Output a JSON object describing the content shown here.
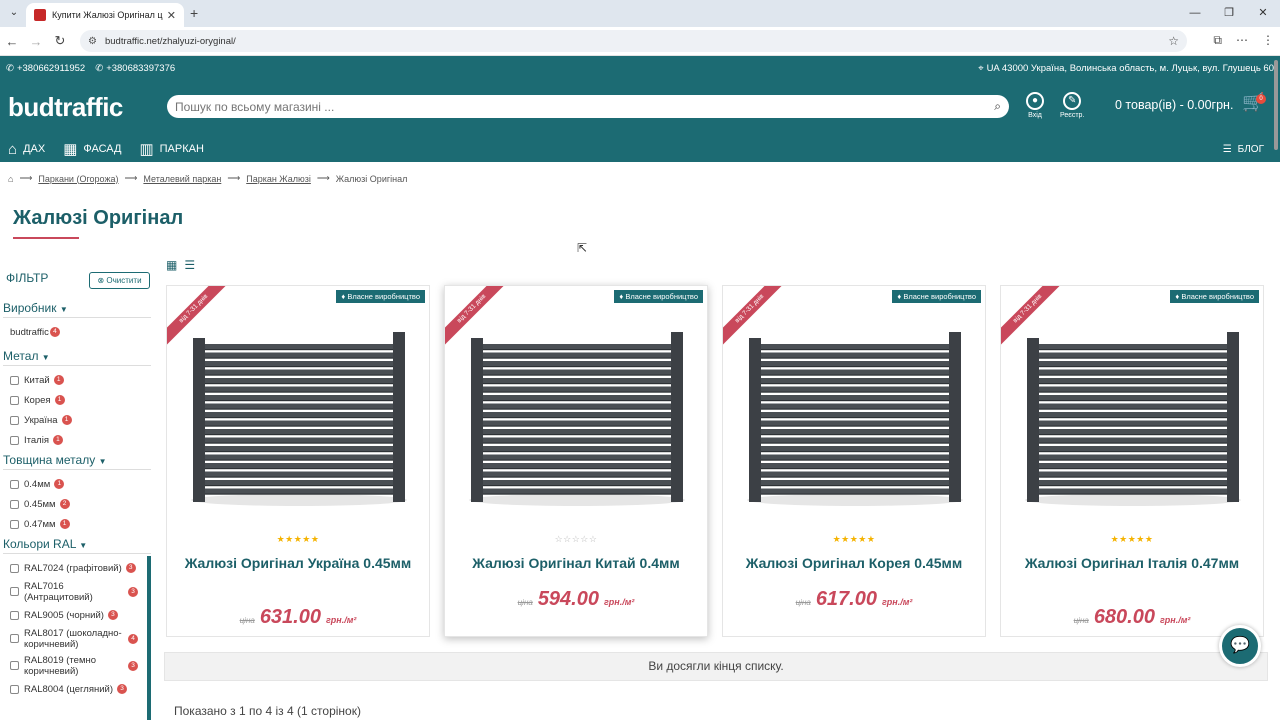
{
  "browser": {
    "tab_title": "Купити Жалюзі Оригінал ціна",
    "url": "budtraffic.net/zhalyuzi-oryginal/"
  },
  "header": {
    "phone1": "+380662911952",
    "phone2": "+380683397376",
    "address": "UA 43000 Україна, Волинська область, м. Луцьк, вул. Глушець 60",
    "logo": "budtraffic",
    "search_placeholder": "Пошук по всьому магазині ...",
    "login_label": "Вхід",
    "register_label": "Реєстр.",
    "cart_text": "0 товар(ів) - 0.00грн.",
    "cart_count": "0"
  },
  "nav": {
    "items": [
      "ДАХ",
      "ФАСАД",
      "ПАРКАН"
    ],
    "blog": "БЛОГ"
  },
  "breadcrumb": [
    "Паркани (Огорожа)",
    "Металевий паркан",
    "Паркан Жалюзі",
    "Жалюзі Оригінал"
  ],
  "page_title": "Жалюзі Оригінал",
  "filter": {
    "title": "ФІЛЬТР",
    "clear": "Очистити",
    "sections": {
      "maker": {
        "title": "Виробник",
        "options": [
          {
            "label": "budtraffic",
            "count": "4"
          }
        ]
      },
      "metal": {
        "title": "Метал",
        "options": [
          {
            "label": "Китай",
            "count": "1"
          },
          {
            "label": "Корея",
            "count": "1"
          },
          {
            "label": "Україна",
            "count": "1"
          },
          {
            "label": "Італія",
            "count": "1"
          }
        ]
      },
      "thickness": {
        "title": "Товщина металу",
        "options": [
          {
            "label": "0.4мм",
            "count": "1"
          },
          {
            "label": "0.45мм",
            "count": "2"
          },
          {
            "label": "0.47мм",
            "count": "1"
          }
        ]
      },
      "colors": {
        "title": "Кольори RAL",
        "options": [
          {
            "label": "RAL7024 (графітовий)",
            "count": "3"
          },
          {
            "label": "RAL7016 (Антрацитовий)",
            "count": "3"
          },
          {
            "label": "RAL9005 (чорний)",
            "count": "3"
          },
          {
            "label": "RAL8017 (шоколадно-коричневий)",
            "count": "4"
          },
          {
            "label": "RAL8019 (темно коричневий)",
            "count": "3"
          },
          {
            "label": "RAL8004 (цегляний)",
            "count": "3"
          }
        ]
      }
    }
  },
  "products": [
    {
      "ribbon": "від 7-31 днів",
      "badge": "Власне виробництво",
      "name": "Жалюзі Оригінал Україна 0.45мм",
      "price_label": "ціна",
      "price": "631.00",
      "unit": "грн./м²",
      "rating": 5
    },
    {
      "ribbon": "від 7-31 днів",
      "badge": "Власне виробництво",
      "name": "Жалюзі Оригінал Китай 0.4мм",
      "price_label": "ціна",
      "price": "594.00",
      "unit": "грн./м²",
      "rating": 0
    },
    {
      "ribbon": "від 7-31 днів",
      "badge": "Власне виробництво",
      "name": "Жалюзі Оригінал Корея 0.45мм",
      "price_label": "ціна",
      "price": "617.00",
      "unit": "грн./м²",
      "rating": 5
    },
    {
      "ribbon": "від 7-31 днів",
      "badge": "Власне виробництво",
      "name": "Жалюзі Оригінал Італія 0.47мм",
      "price_label": "ціна",
      "price": "680.00",
      "unit": "грн./м²",
      "rating": 5
    }
  ],
  "end_of_list": "Ви досягли кінця списку.",
  "shown_text": "Показано з 1 по 4 із 4 (1 сторінок)"
}
